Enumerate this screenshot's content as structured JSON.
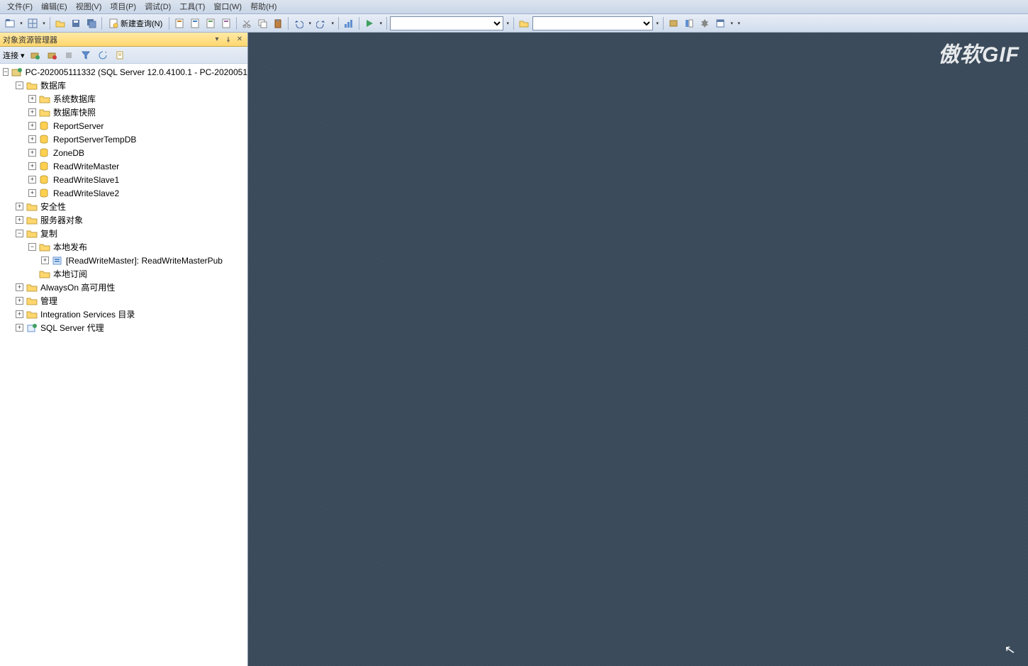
{
  "menu": {
    "items": [
      "文件(F)",
      "编辑(E)",
      "视图(V)",
      "项目(P)",
      "调试(D)",
      "工具(T)",
      "窗口(W)",
      "帮助(H)"
    ]
  },
  "toolbar": {
    "new_query": "新建查询(N)"
  },
  "explorer": {
    "title": "对象资源管理器",
    "connect_label": "连接 ▾",
    "root": "PC-202005111332 (SQL Server 12.0.4100.1 - PC-2020051",
    "nodes": {
      "databases": "数据库",
      "sys_db": "系统数据库",
      "db_snapshot": "数据库快照",
      "report_server": "ReportServer",
      "report_server_temp": "ReportServerTempDB",
      "zonedb": "ZoneDB",
      "rw_master": "ReadWriteMaster",
      "rw_slave1": "ReadWriteSlave1",
      "rw_slave2": "ReadWriteSlave2",
      "security": "安全性",
      "server_objects": "服务器对象",
      "replication": "复制",
      "local_pub": "本地发布",
      "pub_item": "[ReadWriteMaster]: ReadWriteMasterPub",
      "local_sub": "本地订阅",
      "alwayson": "AlwaysOn 高可用性",
      "management": "管理",
      "integration": "Integration Services 目录",
      "agent": "SQL Server 代理"
    }
  },
  "watermark": "傲软GIF"
}
